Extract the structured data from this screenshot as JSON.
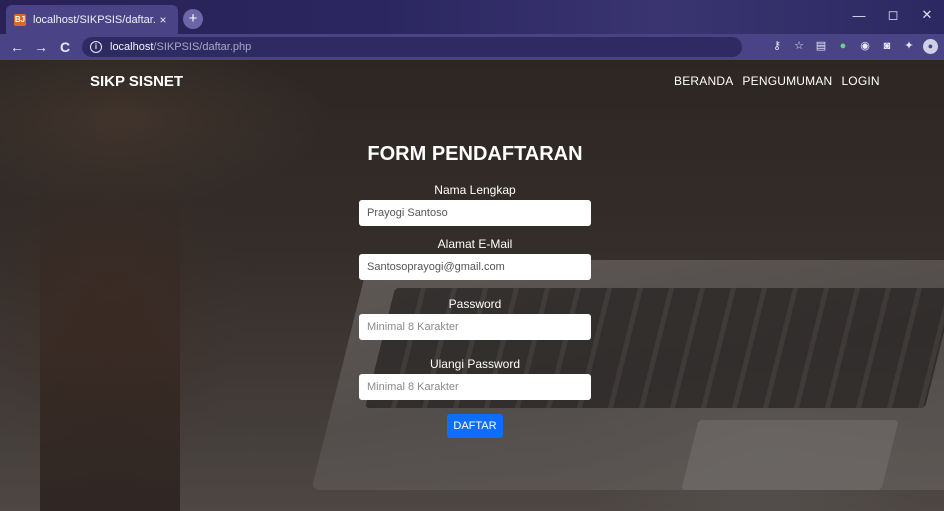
{
  "browser": {
    "tab_title": "localhost/SIKPSIS/daftar.php",
    "favicon_text": "BJ",
    "tab_close": "×",
    "new_tab": "+",
    "url_host": "localhost",
    "url_path": "/SIKPSIS/daftar.php",
    "back": "←",
    "forward": "→",
    "reload": "C",
    "info": "i",
    "window_controls": {
      "minimize": "—",
      "maximize": "◻",
      "close": "✕"
    },
    "extensions": [
      "key-icon",
      "star-icon",
      "reader-icon",
      "color-icon",
      "globe-icon",
      "camera-icon",
      "puzzle-icon",
      "profile-icon"
    ]
  },
  "site": {
    "brand": "SIKP SISNET",
    "nav": [
      "BERANDA",
      "PENGUMUMAN",
      "LOGIN"
    ]
  },
  "form": {
    "title": "FORM PENDAFTARAN",
    "fields": [
      {
        "label": "Nama Lengkap",
        "value": "Prayogi Santoso",
        "placeholder": ""
      },
      {
        "label": "Alamat E-Mail",
        "value": "Santosoprayogi@gmail.com",
        "placeholder": ""
      },
      {
        "label": "Password",
        "value": "",
        "placeholder": "Minimal 8 Karakter"
      },
      {
        "label": "Ulangi Password",
        "value": "",
        "placeholder": "Minimal 8 Karakter"
      }
    ],
    "submit_label": "DAFTAR"
  },
  "colors": {
    "accent": "#0d6efd",
    "chrome": "#4a4385",
    "tabstrip": "#2a2256"
  }
}
